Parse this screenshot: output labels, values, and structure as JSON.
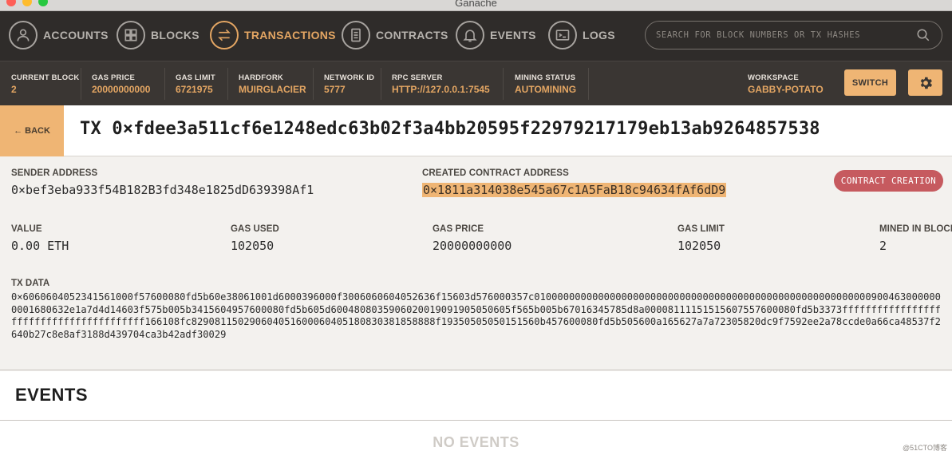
{
  "window": {
    "title": "Ganache"
  },
  "nav": {
    "items": [
      {
        "label": "ACCOUNTS",
        "icon": "person-icon"
      },
      {
        "label": "BLOCKS",
        "icon": "grid-icon"
      },
      {
        "label": "TRANSACTIONS",
        "icon": "swap-arrows-icon",
        "active": true
      },
      {
        "label": "CONTRACTS",
        "icon": "document-icon"
      },
      {
        "label": "EVENTS",
        "icon": "bell-icon"
      },
      {
        "label": "LOGS",
        "icon": "terminal-icon"
      }
    ],
    "search_placeholder": "SEARCH FOR BLOCK NUMBERS OR TX HASHES"
  },
  "status": {
    "current_block": {
      "label": "CURRENT BLOCK",
      "value": "2"
    },
    "gas_price": {
      "label": "GAS PRICE",
      "value": "20000000000"
    },
    "gas_limit": {
      "label": "GAS LIMIT",
      "value": "6721975"
    },
    "hardfork": {
      "label": "HARDFORK",
      "value": "MUIRGLACIER"
    },
    "network_id": {
      "label": "NETWORK ID",
      "value": "5777"
    },
    "rpc_server": {
      "label": "RPC SERVER",
      "value": "HTTP://127.0.0.1:7545"
    },
    "mining_status": {
      "label": "MINING STATUS",
      "value": "AUTOMINING"
    },
    "workspace": {
      "label": "WORKSPACE",
      "value": "GABBY-POTATO"
    },
    "switch_label": "SWITCH"
  },
  "tx": {
    "back_label": "← BACK",
    "title": "TX 0×fdee3a511cf6e1248edc63b02f3a4bb20595f22979217179eb13ab9264857538",
    "sender": {
      "label": "SENDER ADDRESS",
      "value": "0×bef3eba933f54B182B3fd348e1825dD639398Af1"
    },
    "created_contract": {
      "label": "CREATED CONTRACT ADDRESS",
      "value": "0×1811a314038e545a67c1A5FaB18c94634fAf6dD9"
    },
    "badge": "CONTRACT CREATION",
    "value": {
      "label": "VALUE",
      "value": "0.00 ETH"
    },
    "gas_used": {
      "label": "GAS USED",
      "value": "102050"
    },
    "gas_price": {
      "label": "GAS PRICE",
      "value": "20000000000"
    },
    "gas_limit": {
      "label": "GAS LIMIT",
      "value": "102050"
    },
    "mined_in_block": {
      "label": "MINED IN BLOCK",
      "value": "2"
    },
    "tx_data": {
      "label": "TX DATA",
      "value": "0×6060604052341561000f57600080fd5b60e38061001d6000396000f3006060604052636f15603d576000357c01000000000000000000000000000000000000000000000000000000009004630000000001680632e1a7d4d14603f575b005b3415604957600080fd5b605d6004808035906020019091905050605f565b005b67016345785d8a00008111151515607557600080fd5b3373ffffffffffffffffffffffffffffffffffffffff166108fc829081150290604051600060405180830381858888f19350505050151560b457600080fd5b505600a165627a7a72305820dc9f7592ee2a78ccde0a66ca48537f2640b27c8e8af3188d439704ca3b42adf30029"
    }
  },
  "events": {
    "title": "EVENTS",
    "empty_text": "NO EVENTS"
  },
  "watermark": "@51CTO博客"
}
